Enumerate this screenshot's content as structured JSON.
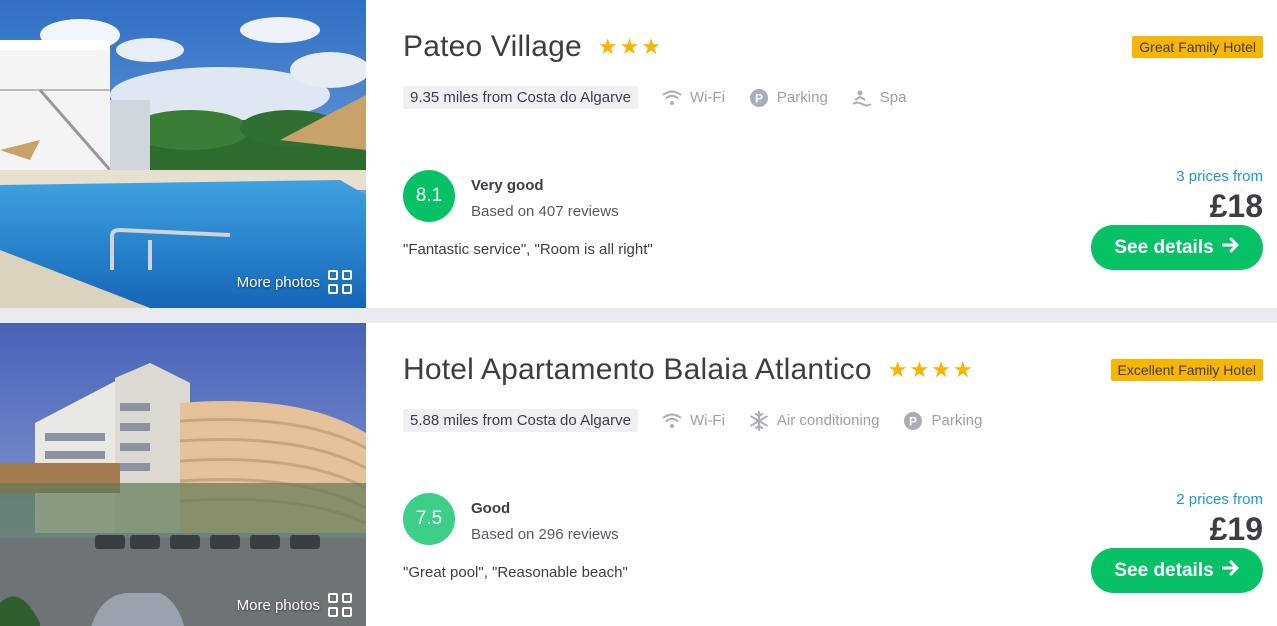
{
  "hotels": [
    {
      "name": "Pateo Village",
      "stars": "★★★",
      "star_count": 3,
      "badge": "Great Family Hotel",
      "distance": "9.35 miles from Costa do Algarve",
      "amenities": [
        {
          "label": "Wi-Fi",
          "icon": "wifi-icon"
        },
        {
          "label": "Parking",
          "icon": "parking-icon"
        },
        {
          "label": "Spa",
          "icon": "spa-icon"
        }
      ],
      "score": "8.1",
      "score_color": "#06c166",
      "rating_word": "Very good",
      "reviews": "Based on 407 reviews",
      "quote": "\"Fantastic service\", \"Room is all right\"",
      "prices_from": "3 prices from",
      "price": "£18",
      "button_label": "See details",
      "more_photos": "More photos"
    },
    {
      "name": "Hotel Apartamento Balaia Atlantico",
      "stars": "★★★★",
      "star_count": 4,
      "badge": "Excellent Family Hotel",
      "distance": "5.88 miles from Costa do Algarve",
      "amenities": [
        {
          "label": "Wi-Fi",
          "icon": "wifi-icon"
        },
        {
          "label": "Air conditioning",
          "icon": "snowflake-icon"
        },
        {
          "label": "Parking",
          "icon": "parking-icon"
        }
      ],
      "score": "7.5",
      "score_color": "#3ccf88",
      "rating_word": "Good",
      "reviews": "Based on 296 reviews",
      "quote": "\"Great pool\", \"Reasonable beach\"",
      "prices_from": "2 prices from",
      "price": "£19",
      "button_label": "See details",
      "more_photos": "More photos"
    }
  ]
}
